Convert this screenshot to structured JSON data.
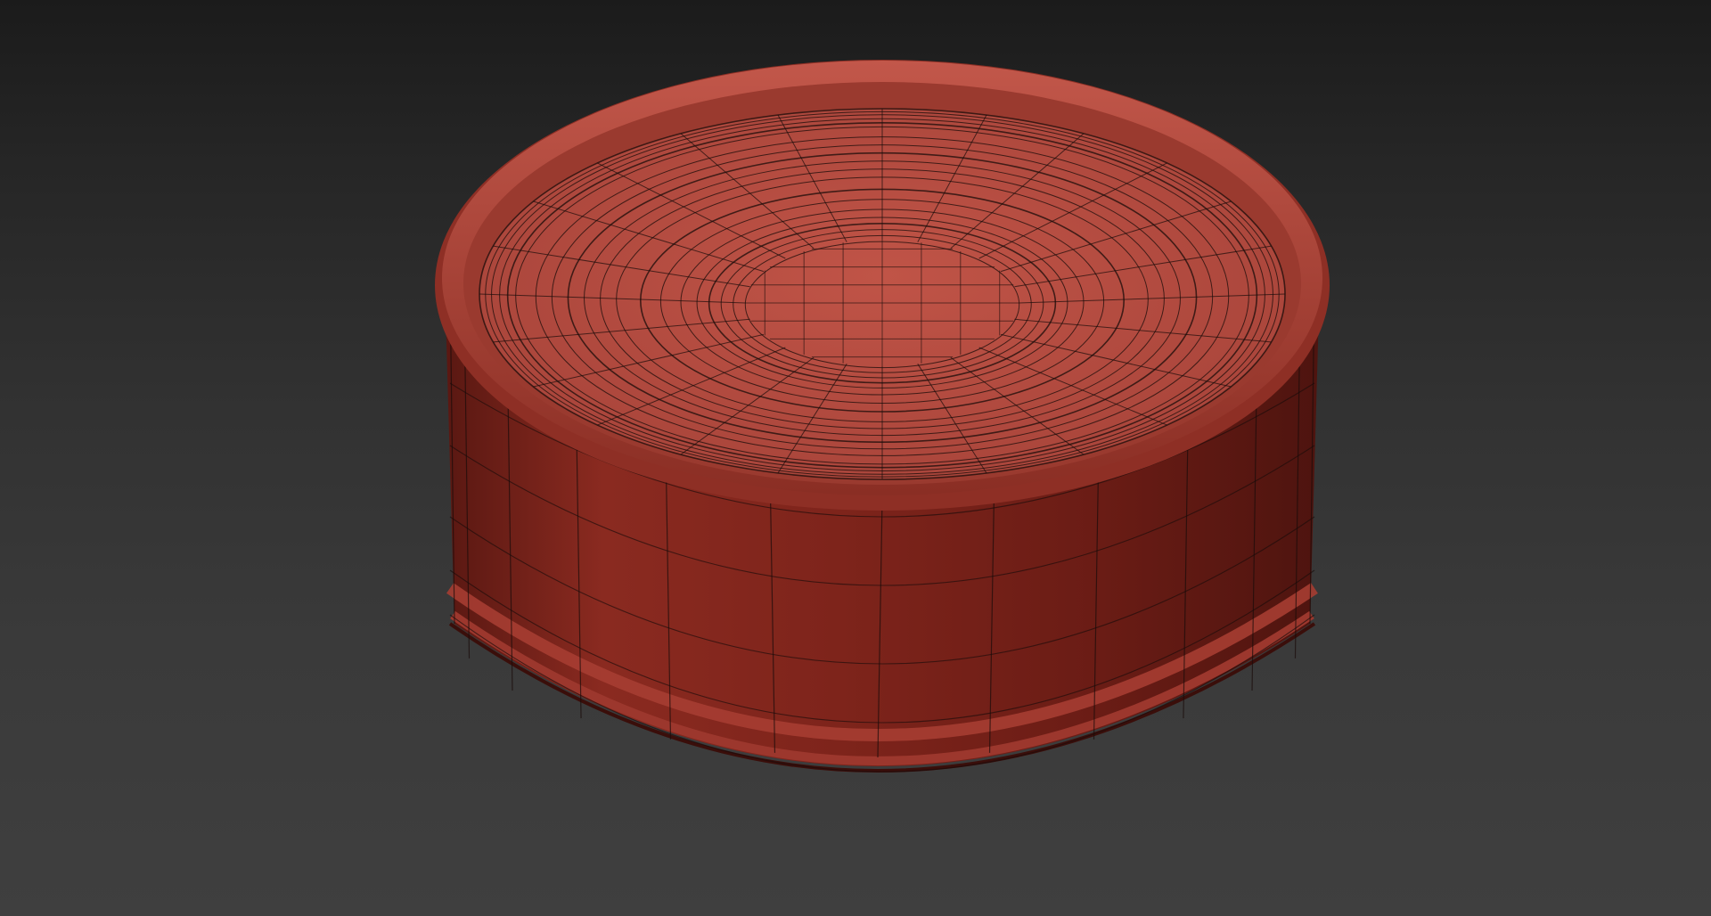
{
  "viewport": {
    "background_top": "#1b1b1b",
    "background_bottom": "#3f3f3f"
  },
  "model": {
    "object": "cylindrical-tin-can",
    "display_mode": "shaded-with-wireframe",
    "material_color": "#b64a3d",
    "material_shadow": "#6e1d16",
    "wire_color": "#1a0c0a"
  }
}
